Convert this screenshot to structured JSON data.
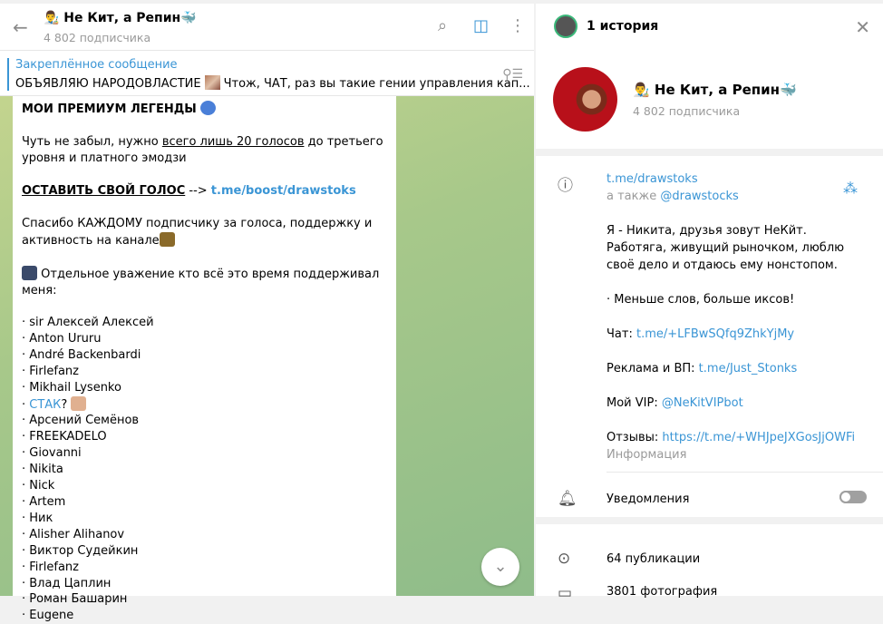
{
  "chat": {
    "title": "👨‍🎨 Не Кит, а Репин🐳",
    "subscribers": "4 802 подписчика",
    "pinned": {
      "label": "Закреплённое сообщение",
      "text_before": "ОБЪЯВЛЯЮ НАРОДОВЛАСТИЕ",
      "text_after": "Чтож, ЧАТ, раз вы такие гении управления кап..."
    },
    "message": {
      "heading": "МОИ ПРЕМИУМ ЛЕГЕНДЫ",
      "p1_a": "Чуть не забыл, нужно ",
      "p1_u": "всего лишь 20 голосов",
      "p1_b": " до третьего уровня и платного эмодзи",
      "vote_label": "ОСТАВИТЬ СВОЙ ГОЛОС",
      "arrow": " --> ",
      "vote_link": "t.me/boost/drawstoks",
      "thanks": "Спасибо КАЖДОМУ подписчику за голоса, поддержку и активность на канале",
      "respect": "Отдельное уважение кто всё это время поддерживал меня:",
      "list": [
        "· sir Алексей Алексей",
        "· Anton Ururu",
        "· André Backenbardi",
        "· Firlefanz",
        "· Mikhail Lysenko",
        "СТАК",
        "· Арсений Семёнов",
        "· FREEKADELO",
        "· Giovanni",
        "· Nikita",
        "· Nick",
        "· Artem",
        "· Ник",
        "· Alisher Alihanov",
        "· Виктор Судейкин",
        "· Firlefanz",
        "· Влад Цаплин",
        "· Роман Башарин",
        "· Eugene"
      ]
    }
  },
  "profile": {
    "stories": "1 история",
    "title": "👨‍🎨 Не Кит, а Репин🐳",
    "subscribers": "4 802 подписчика",
    "link": "t.me/drawstoks",
    "also_label": "а также ",
    "also_user": "@drawstocks",
    "bio1": "Я - Никита, друзья зовут НеКйт. Работяга, живущий рыночком, люблю своё дело и отдаюсь ему нонстопом.",
    "bio2": "· Меньше слов, больше иксов!",
    "chat_label": "Чат: ",
    "chat_link": "t.me/+LFBwSQfq9ZhkYjMy",
    "ads_label": "Реклама и ВП: ",
    "ads_link": "t.me/Just_Stonks",
    "vip_label": "Мой VIP: ",
    "vip_link": "@NeKitVIPbot",
    "reviews_label": "Отзывы: ",
    "reviews_link": "https://t.me/+WHJpeJXGosJjOWFi",
    "info_caption": "Информация",
    "notifications": "Уведомления",
    "notifications_on": false,
    "posts": "64 публикации",
    "photos": "3801 фотография"
  },
  "colors": {
    "accent": "#3a95d5"
  }
}
